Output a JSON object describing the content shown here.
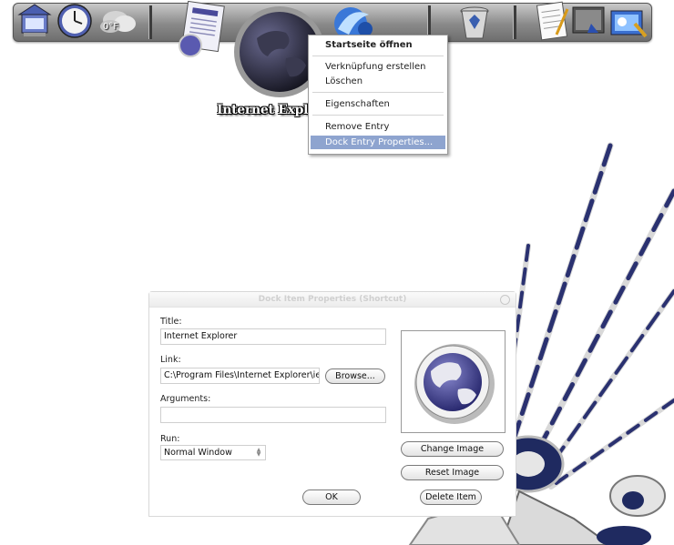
{
  "dock": {
    "hovered_label": "Internet Expl",
    "weather_text": "0°F",
    "items": [
      {
        "name": "computer-icon"
      },
      {
        "name": "clock-icon"
      },
      {
        "name": "weather-icon"
      },
      {
        "name": "document-icon"
      },
      {
        "name": "internet-explorer-icon"
      },
      {
        "name": "program-icon"
      },
      {
        "name": "recycle-bin-icon"
      },
      {
        "name": "notepad-icon"
      },
      {
        "name": "screen-icon"
      },
      {
        "name": "network-icon"
      }
    ]
  },
  "context_menu": {
    "items": [
      {
        "label": "Startseite öffnen",
        "bold": true
      },
      {
        "label": "Verknüpfung erstellen"
      },
      {
        "label": "Löschen"
      },
      {
        "label": "Eigenschaften"
      },
      {
        "label": "Remove Entry"
      },
      {
        "label": "Dock Entry Properties...",
        "selected": true
      }
    ]
  },
  "dialog": {
    "title": "Dock Item Properties (Shortcut)",
    "title_label": "Title:",
    "title_value": "Internet Explorer",
    "link_label": "Link:",
    "link_value": "C:\\Program Files\\Internet Explorer\\iexpl",
    "browse_label": "Browse...",
    "arguments_label": "Arguments:",
    "arguments_value": "",
    "run_label": "Run:",
    "run_value": "Normal Window",
    "change_image_label": "Change Image",
    "reset_image_label": "Reset Image",
    "ok_label": "OK",
    "delete_item_label": "Delete Item"
  },
  "colors": {
    "menu_selection": "#8ea4cf",
    "globe_blue": "#4a4a9a"
  }
}
